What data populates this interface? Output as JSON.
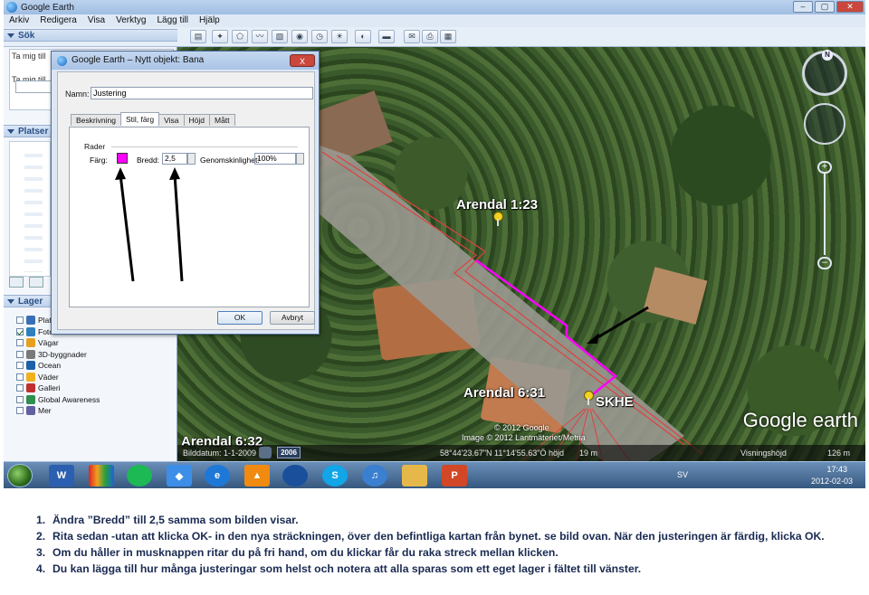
{
  "window": {
    "title": "Google Earth",
    "menu": [
      "Arkiv",
      "Redigera",
      "Visa",
      "Verktyg",
      "Lägg till",
      "Hjälp"
    ]
  },
  "sidebar": {
    "search_header": "Sök",
    "search_tab_label": "Ta mig till",
    "search_tab_label2": "Ta mig till",
    "places_header": "Platser",
    "layers_header": "Lager",
    "layers": [
      {
        "label": "Platser",
        "checked": false,
        "icon_color": "#3a6fb8"
      },
      {
        "label": "Foton",
        "checked": true,
        "icon_color": "#2f7fbf"
      },
      {
        "label": "Vägar",
        "checked": false,
        "icon_color": "#e6a020"
      },
      {
        "label": "3D-byggnader",
        "checked": false,
        "icon_color": "#7a7a7a"
      },
      {
        "label": "Ocean",
        "checked": false,
        "icon_color": "#1d5fa8"
      },
      {
        "label": "Väder",
        "checked": false,
        "icon_color": "#f0b020"
      },
      {
        "label": "Galleri",
        "checked": false,
        "icon_color": "#c03030"
      },
      {
        "label": "Global Awareness",
        "checked": false,
        "icon_color": "#2f8f4f"
      },
      {
        "label": "Mer",
        "checked": false,
        "icon_color": "#6060a0"
      }
    ]
  },
  "dialog": {
    "title": "Google Earth – Nytt objekt: Bana",
    "close_label": "X",
    "name_label": "Namn:",
    "name_value": "Justering",
    "tabs": [
      "Beskrivning",
      "Stil, färg",
      "Visa",
      "Höjd",
      "Mått"
    ],
    "active_tab": 1,
    "section_label": "Rader",
    "color_label": "Färg:",
    "color_value": "#ff00ff",
    "width_label": "Bredd:",
    "width_value": "2,5",
    "opacity_label": "Genomskinlighet:",
    "opacity_value": "100%",
    "ok_label": "OK",
    "cancel_label": "Avbryt"
  },
  "map": {
    "placemarks": [
      {
        "label": "Arendal 1:23"
      },
      {
        "label": "Arendal 6:31"
      },
      {
        "label": "SKHE"
      },
      {
        "label": "Arendal 6:32"
      }
    ],
    "copyright1": "© 2012 Google",
    "copyright2": "Image © 2012 Lantmäteriet/Metria",
    "logo": "Google earth",
    "status": {
      "image_date": "Bilddatum: 1-1-2009",
      "year": "2006",
      "coords": "58°44'23.67\"N  11°14'55.63\"Ö  höjd",
      "elevation": "19 m",
      "eye_label": "Visningshöjd",
      "eye_value": "126 m"
    }
  },
  "taskbar": {
    "language": "SV",
    "time": "17:43",
    "date": "2012-02-03"
  },
  "instructions": [
    {
      "num": "1.",
      "text": "Ändra ”Bredd” till 2,5 samma som bilden visar."
    },
    {
      "num": "2.",
      "text": "Rita sedan -utan att klicka OK- in den nya sträckningen, över den befintliga kartan från bynet.  se bild ovan. När den justeringen är färdig, klicka OK."
    },
    {
      "num": "3.",
      "text": "Om du håller in musknappen ritar du på fri hand, om du klickar får du raka streck mellan klicken."
    },
    {
      "num": "4.",
      "text": "Du kan lägga till hur många justeringar som helst och notera att alla sparas som ett eget lager i fältet till vänster."
    }
  ]
}
